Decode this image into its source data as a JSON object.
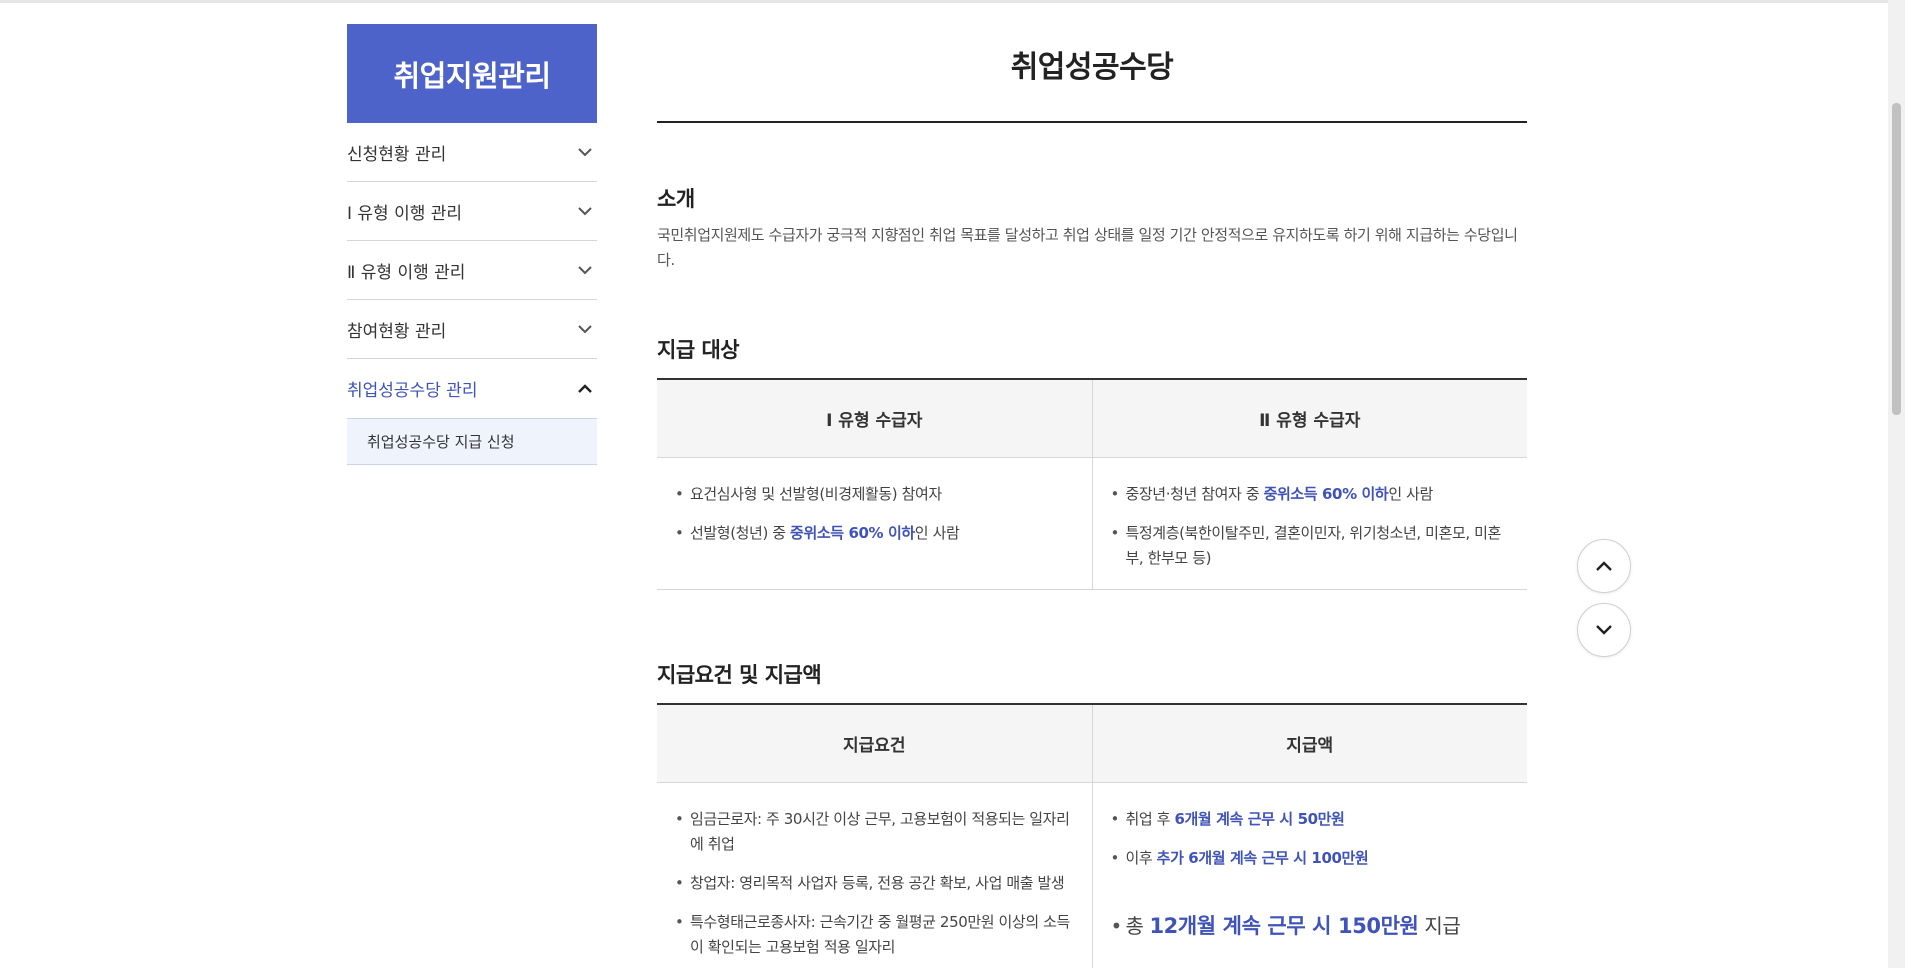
{
  "sidebar": {
    "title": "취업지원관리",
    "items": [
      {
        "label": "신청현황 관리"
      },
      {
        "label": "Ⅰ 유형 이행 관리"
      },
      {
        "label": "Ⅱ 유형 이행 관리"
      },
      {
        "label": "참여현황 관리"
      },
      {
        "label": "취업성공수당 관리"
      }
    ],
    "sub_item": "취업성공수당 지급 신청"
  },
  "main": {
    "title": "취업성공수당",
    "intro": {
      "heading": "소개",
      "text": "국민취업지원제도 수급자가 궁극적 지향점인 취업 목표를 달성하고 취업 상태를 일정 기간 안정적으로 유지하도록 하기 위해 지급하는 수당입니다."
    },
    "target": {
      "heading": "지급 대상",
      "col1_header": "Ⅰ 유형 수급자",
      "col2_header": "Ⅱ 유형 수급자",
      "col1_item1": "요건심사형 및 선발형(비경제활동) 참여자",
      "col1_item2_pre": "선발형(청년) 중 ",
      "col1_item2_hl": "중위소득 60% 이하",
      "col1_item2_post": "인 사람",
      "col2_item1_pre": "중장년·청년 참여자 중 ",
      "col2_item1_hl": "중위소득 60% 이하",
      "col2_item1_post": "인 사람",
      "col2_item2": "특정계층(북한이탈주민, 결혼이민자, 위기청소년, 미혼모, 미혼부, 한부모 등)"
    },
    "requirements": {
      "heading": "지급요건 및 지급액",
      "col1_header": "지급요건",
      "col2_header": "지급액",
      "req1": "임금근로자: 주 30시간 이상 근무, 고용보험이 적용되는 일자리에 취업",
      "req2": "창업자: 영리목적 사업자 등록, 전용 공간 확보, 사업 매출 발생",
      "req3": "특수형태근로종사자: 근속기간 중 월평균 250만원 이상의 소득이 확인되는 고용보험 적용 일자리",
      "amt1_pre": "취업 후 ",
      "amt1_hl": "6개월 계속 근무 시 50만원",
      "amt2_pre": "이후 ",
      "amt2_hl": "추가 6개월 계속 근무 시 100만원",
      "total_pre": "총 ",
      "total_hl": "12개월 계속 근무 시 150만원",
      "total_post": " 지급"
    }
  }
}
